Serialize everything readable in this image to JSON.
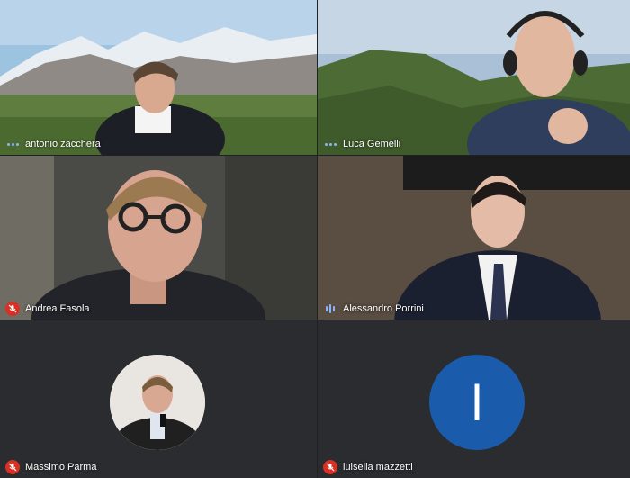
{
  "participants": [
    {
      "name": "antonio zacchera",
      "status": "speaking"
    },
    {
      "name": "Luca Gemelli",
      "status": "speaking"
    },
    {
      "name": "Andrea Fasola",
      "status": "muted"
    },
    {
      "name": "Alessandro Porrini",
      "status": "active-audio"
    },
    {
      "name": "Massimo Parma",
      "status": "muted"
    },
    {
      "name": "luisella mazzetti",
      "status": "muted",
      "avatar_letter": "l"
    }
  ],
  "colors": {
    "background": "#202124",
    "mic_off": "#d93025",
    "speaking": "#8ab4f8",
    "avatar_blue": "#1a5bab"
  }
}
